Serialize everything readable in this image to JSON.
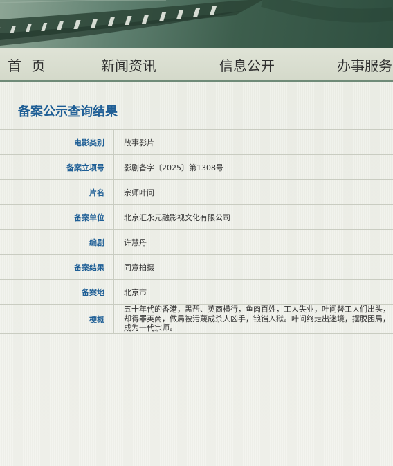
{
  "nav": {
    "home": "首 页",
    "news": "新闻资讯",
    "info": "信息公开",
    "service": "办事服务"
  },
  "result": {
    "title": "备案公示查询结果",
    "rows": [
      {
        "label": "电影类别",
        "value": "故事影片"
      },
      {
        "label": "备案立项号",
        "value": "影剧备字〔2025〕第1308号"
      },
      {
        "label": "片名",
        "value": "宗师叶问"
      },
      {
        "label": "备案单位",
        "value": "北京汇永元融影视文化有限公司"
      },
      {
        "label": "编剧",
        "value": "许慧丹"
      },
      {
        "label": "备案结果",
        "value": "同意拍摄"
      },
      {
        "label": "备案地",
        "value": "北京市"
      },
      {
        "label": "梗概",
        "value": "五十年代的香港，黑帮、英商横行，鱼肉百姓，工人失业，叶问替工人们出头，却得罪英商，做局被污蔑成杀人凶手，锒铛入狱。叶问终走出迷境，摆脱困局，成为一代宗师。"
      }
    ]
  },
  "colors": {
    "accent": "#1f5f96",
    "nav_border": "#6f8b78",
    "banner": "#3d5e4d"
  },
  "icons": {
    "banner": "film-strip-graphic"
  }
}
